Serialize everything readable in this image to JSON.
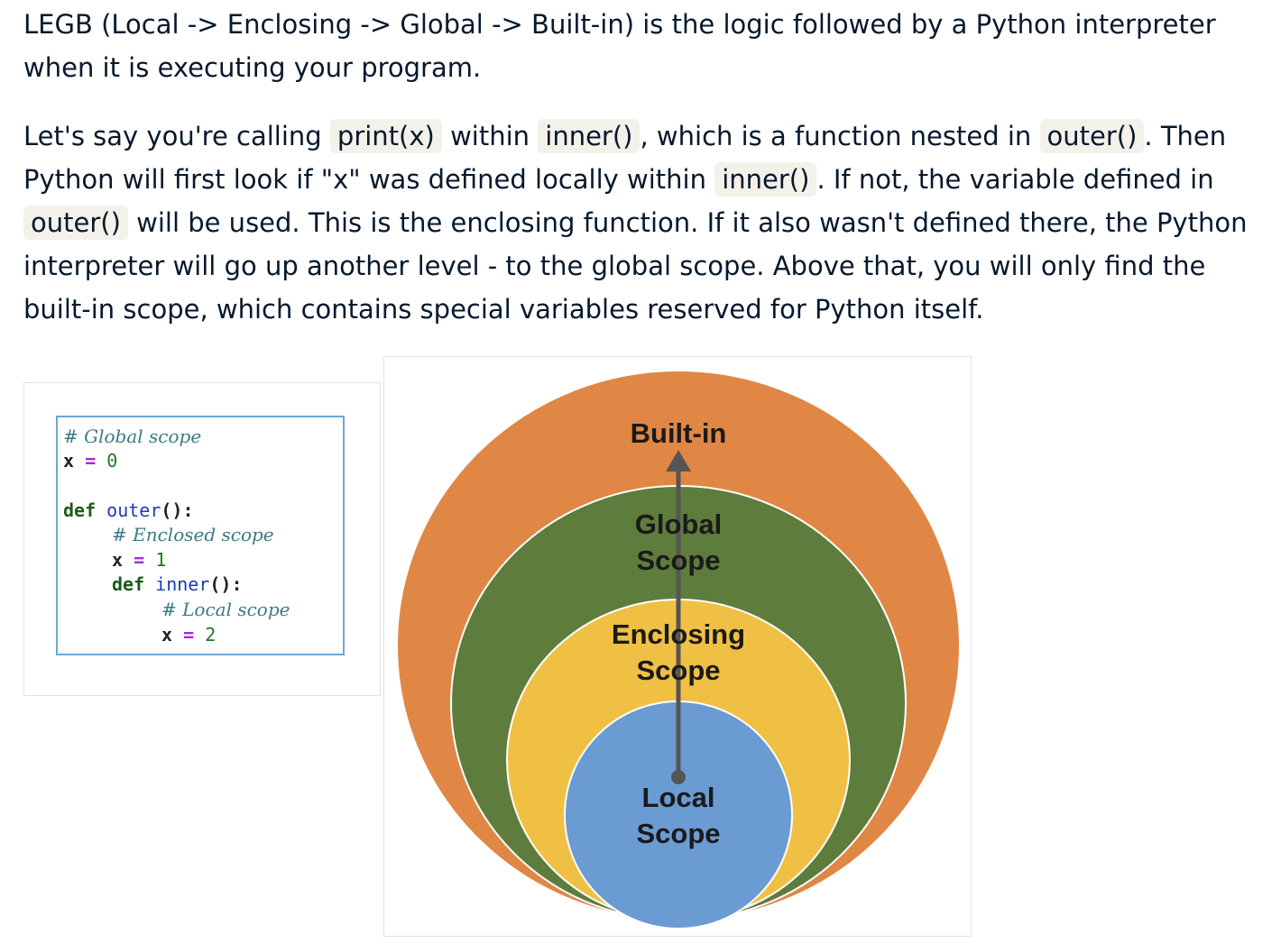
{
  "intro": {
    "text": "LEGB (Local -> Enclosing -> Global -> Built-in) is the logic followed by a Python interpreter when it is executing your program."
  },
  "explanation": {
    "s1": "Let's say you're calling ",
    "code_print": "print(x)",
    "s2": " within ",
    "code_inner1": "inner()",
    "s3": ", which is a function nested in ",
    "code_outer1": "outer()",
    "s4": ". Then Python will first look if \"x\" was defined locally within ",
    "code_inner2": "inner()",
    "s5": ". If not, the variable defined in ",
    "code_outer2": "outer()",
    "s6": " will be used. This is the enclosing function. If it also wasn't defined there, the Python interpreter will go up another level - to the global scope. Above that, you will only find the built-in scope, which contains special variables reserved for Python itself."
  },
  "code_example": {
    "comment_global": "# Global scope",
    "kw_def": "def",
    "fn_outer": "outer",
    "fn_inner": "inner",
    "paren_colon": "():",
    "comment_enclosed": "# Enclosed scope",
    "comment_local": "# Local scope",
    "var": "x",
    "op": "=",
    "val_global": "0",
    "val_enclosed": "1",
    "val_local": "2"
  },
  "diagram": {
    "builtin_label": "Built-in",
    "global_label_1": "Global",
    "global_label_2": "Scope",
    "enclosing_label_1": "Enclosing",
    "enclosing_label_2": "Scope",
    "local_label_1": "Local",
    "local_label_2": "Scope",
    "colors": {
      "builtin": "#e08746",
      "global": "#5e7d3c",
      "enclosing": "#f0c044",
      "local": "#6b9bd3",
      "arrow": "#555555"
    }
  }
}
